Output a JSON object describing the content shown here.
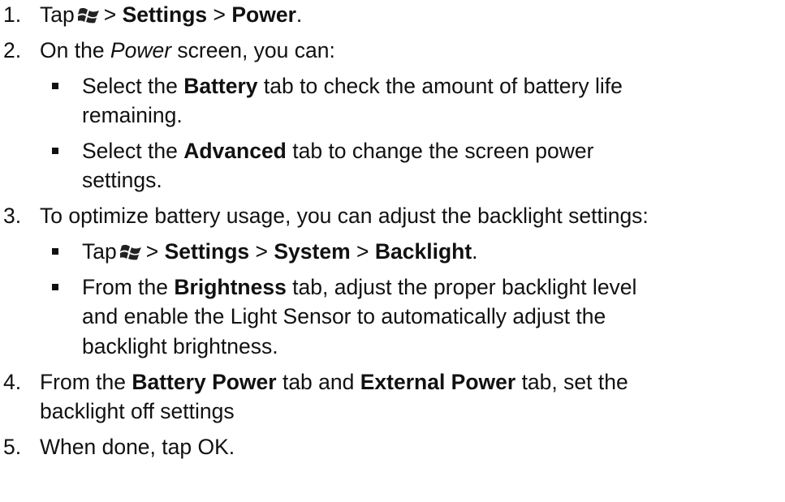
{
  "steps": {
    "s1": {
      "num": "1.",
      "tap": "Tap",
      "sep1": ">",
      "settings": "Settings",
      "sep2": ">",
      "power": "Power",
      "end": "."
    },
    "s2": {
      "num": "2.",
      "pre": "On the ",
      "power": "Power",
      "post": " screen, you can:",
      "b1": {
        "pre": "Select the ",
        "bold": "Battery",
        "post": " tab to check the amount of battery life",
        "cont": "remaining."
      },
      "b2": {
        "pre": "Select the ",
        "bold": "Advanced",
        "post": " tab to change the screen power",
        "cont": "settings."
      }
    },
    "s3": {
      "num": "3.",
      "text": "To optimize battery usage, you can adjust the backlight settings:",
      "b1": {
        "tap": "Tap",
        "sep1": ">",
        "settings": "Settings",
        "sep2": ">",
        "system": "System",
        "sep3": ">",
        "backlight": "Backlight",
        "end": "."
      },
      "b2": {
        "pre": "From the ",
        "bold": "Brightness",
        "post": " tab, adjust the proper backlight level",
        "cont1": "and enable the Light Sensor to automatically adjust the",
        "cont2": "backlight brightness."
      }
    },
    "s4": {
      "num": "4.",
      "pre": "From the ",
      "bold1": "Battery Power",
      "mid": " tab and ",
      "bold2": "External Power",
      "post": " tab, set the",
      "cont": "backlight off settings"
    },
    "s5": {
      "num": "5.",
      "text": "When done, tap OK."
    }
  },
  "icons": {
    "start": "windows-start-icon"
  },
  "colors": {
    "text": "#111111",
    "background": "#ffffff"
  }
}
